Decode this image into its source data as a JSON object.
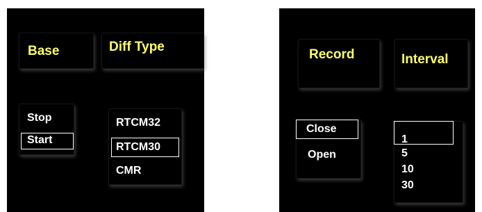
{
  "left_panel": {
    "base_header": "Base",
    "diff_header": "Diff Type",
    "base_options": [
      "Stop",
      "Start"
    ],
    "base_selected": "Start",
    "diff_options": [
      "RTCM32",
      "RTCM30",
      "CMR"
    ],
    "diff_selected": "RTCM30"
  },
  "right_panel": {
    "record_header": "Record",
    "interval_header": "Interval",
    "record_options": [
      "Close",
      "Open"
    ],
    "record_selected": "Close",
    "interval_options": [
      "1",
      "5",
      "10",
      "30"
    ],
    "interval_selected": "1"
  },
  "colors": {
    "background": "#000000",
    "header_text": "#ffff66",
    "option_text": "#ffffff"
  }
}
